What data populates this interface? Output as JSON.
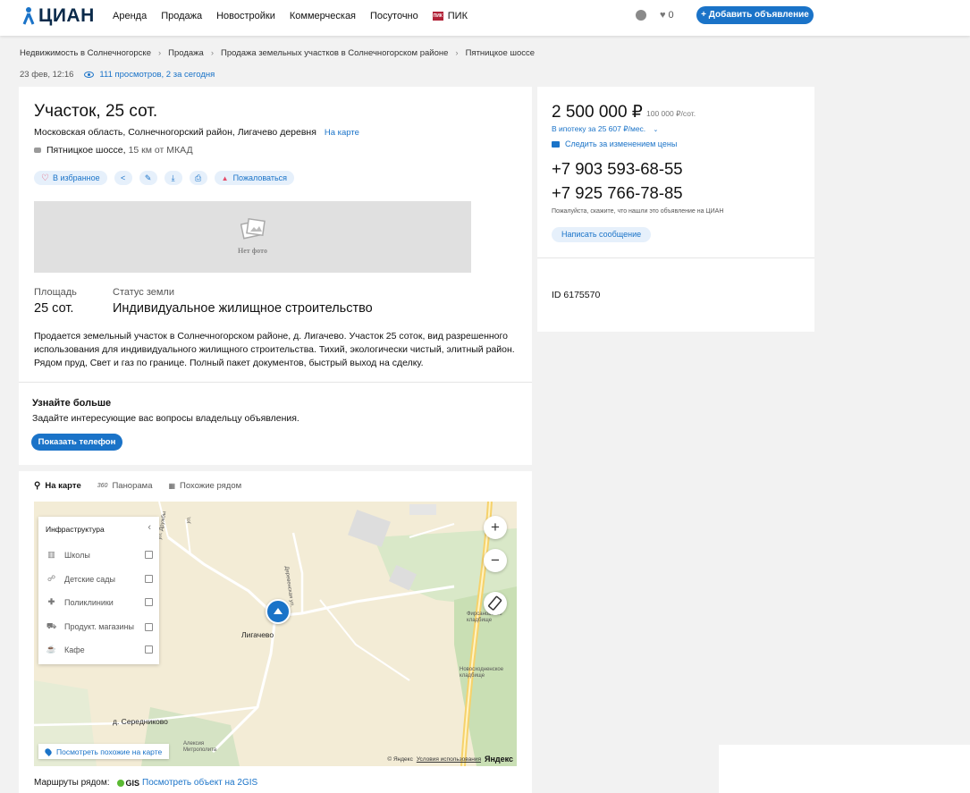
{
  "header": {
    "logo_text": "ЦИАН",
    "nav": [
      "Аренда",
      "Продажа",
      "Новостройки",
      "Коммерческая",
      "Посуточно"
    ],
    "pik_label": "ПИК",
    "favorites_count": "0",
    "add_button": "+ Добавить объявление"
  },
  "breadcrumbs": [
    "Недвижимость в Солнечногорске",
    "Продажа",
    "Продажа земельных участков в Солнечногорском районе",
    "Пятницкое шоссе"
  ],
  "meta": {
    "date": "23 фев, 12:16",
    "views": "111 просмотров, 2 за сегодня"
  },
  "listing": {
    "title": "Участок, 25 сот.",
    "address": "Московская область, Солнечногорский район, Лигачево деревня",
    "map_link": "На карте",
    "highway": "Пятницкое шоссе,",
    "distance": "15 км от МКАД",
    "favorite_button": "В избранное",
    "report_button": "Пожаловаться",
    "no_photo": "Нет фото",
    "area_label": "Площадь",
    "area_value": "25 сот.",
    "status_label": "Статус земли",
    "status_value": "Индивидуальное жилищное строительство",
    "description": "Продается земельный участок в Солнечногорском районе, д. Лигачево. Участок 25 соток, вид разрешенного использования для индивидуального жилищного строительства. Тихий, экологически чистый, элитный район. Рядом пруд, Свет и газ по границе. Полный пакет документов, быстрый выход на сделку.",
    "learn_title": "Узнайте больше",
    "learn_sub": "Задайте интересующие вас вопросы владельцу объявления.",
    "show_phone": "Показать телефон"
  },
  "map_section": {
    "tabs": [
      "На карте",
      "Панорама",
      "Похожие рядом"
    ],
    "tab_360": "360",
    "infrastructure_title": "Инфраструктура",
    "infrastructure": [
      "Школы",
      "Детские сады",
      "Поликлиники",
      "Продукт. магазины",
      "Кафе"
    ],
    "labels": {
      "village": "Лигачево",
      "village2": "д. Середниково",
      "street1": "Деревенская ул.",
      "street2": "ул. Дружбы",
      "street3": "ул.",
      "cemetery1": "Фирсановское кладбище",
      "cemetery2": "Новосходненское кладбище",
      "church": "Алексия Митрополита"
    },
    "see_similar": "Посмотреть похожие на карте",
    "attribution": "© Яндекс",
    "terms": "Условия использования",
    "yandex": "Яндекс",
    "routes_label": "Маршруты рядом:",
    "gis_label": "GIS",
    "gis_link": "Посмотреть объект на 2GIS"
  },
  "sidebar": {
    "price": "2 500 000 ₽",
    "price_per": "100 000 ₽/сот.",
    "mortgage": "В ипотеку за 25 607 ₽/мес.",
    "follow": "Следить за изменением цены",
    "phones": [
      "+7 903 593-68-55",
      "+7 925 766-78-85"
    ],
    "note": "Пожалуйста, скажите, что нашли это объявление на ЦИАН",
    "message_button": "Написать сообщение",
    "listing_id": "ID 6175570"
  },
  "colors": {
    "accent": "#1a73c8",
    "heart": "#e44c6a"
  }
}
